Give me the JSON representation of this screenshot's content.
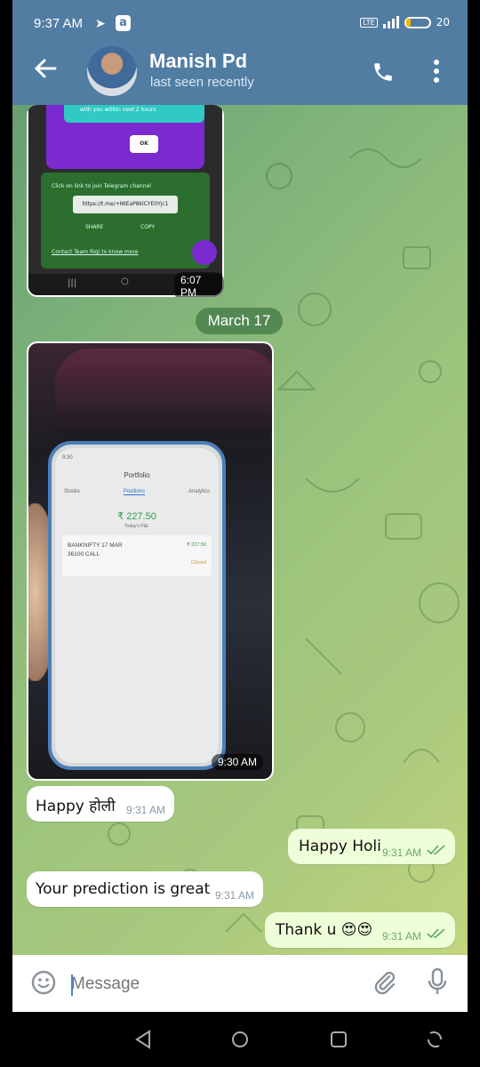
{
  "status_bar": {
    "time": "9:37 AM",
    "app_badge": "a",
    "network": "LTE",
    "battery": "20"
  },
  "chat_header": {
    "name": "Manish Pd",
    "status": "last seen recently"
  },
  "messages": {
    "screenshot1": {
      "teal_text": "with you within next 2 hours",
      "ok": "OK",
      "join_text": "Click on link to join Telegram channel",
      "link": "https://t.me/+NtEaP8klCYE0Yjc1",
      "share": "SHARE",
      "copy": "COPY",
      "contact": "Contact Team Rigi to know more",
      "time": "6:07 PM"
    },
    "date_divider": "March 17",
    "screenshot2": {
      "phone_time": "9:30",
      "portfolio_title": "Portfolio",
      "tabs": [
        "Stocks",
        "Positions",
        "Analytics"
      ],
      "pnl": "₹ 227.50",
      "pnl_label": "Today's P&L",
      "position_line1": "BANKNIFTY 17 MAR",
      "position_line2": "36100 CALL",
      "position_pnl": "₹ 227.50",
      "position_status": "Closed",
      "time": "9:30 AM"
    },
    "m1": {
      "text": "Happy होली",
      "time": "9:31 AM"
    },
    "m2": {
      "text": "Happy Holi",
      "time": "9:31 AM"
    },
    "m3": {
      "text": "Your prediction is great",
      "time": "9:31 AM"
    },
    "m4": {
      "text": "Thank u 😍😍",
      "time": "9:31 AM"
    }
  },
  "composer": {
    "placeholder": "Message"
  },
  "colors": {
    "header": "#527da3",
    "outgoing_bubble": "#eefed9",
    "incoming_bubble": "#ffffff"
  }
}
